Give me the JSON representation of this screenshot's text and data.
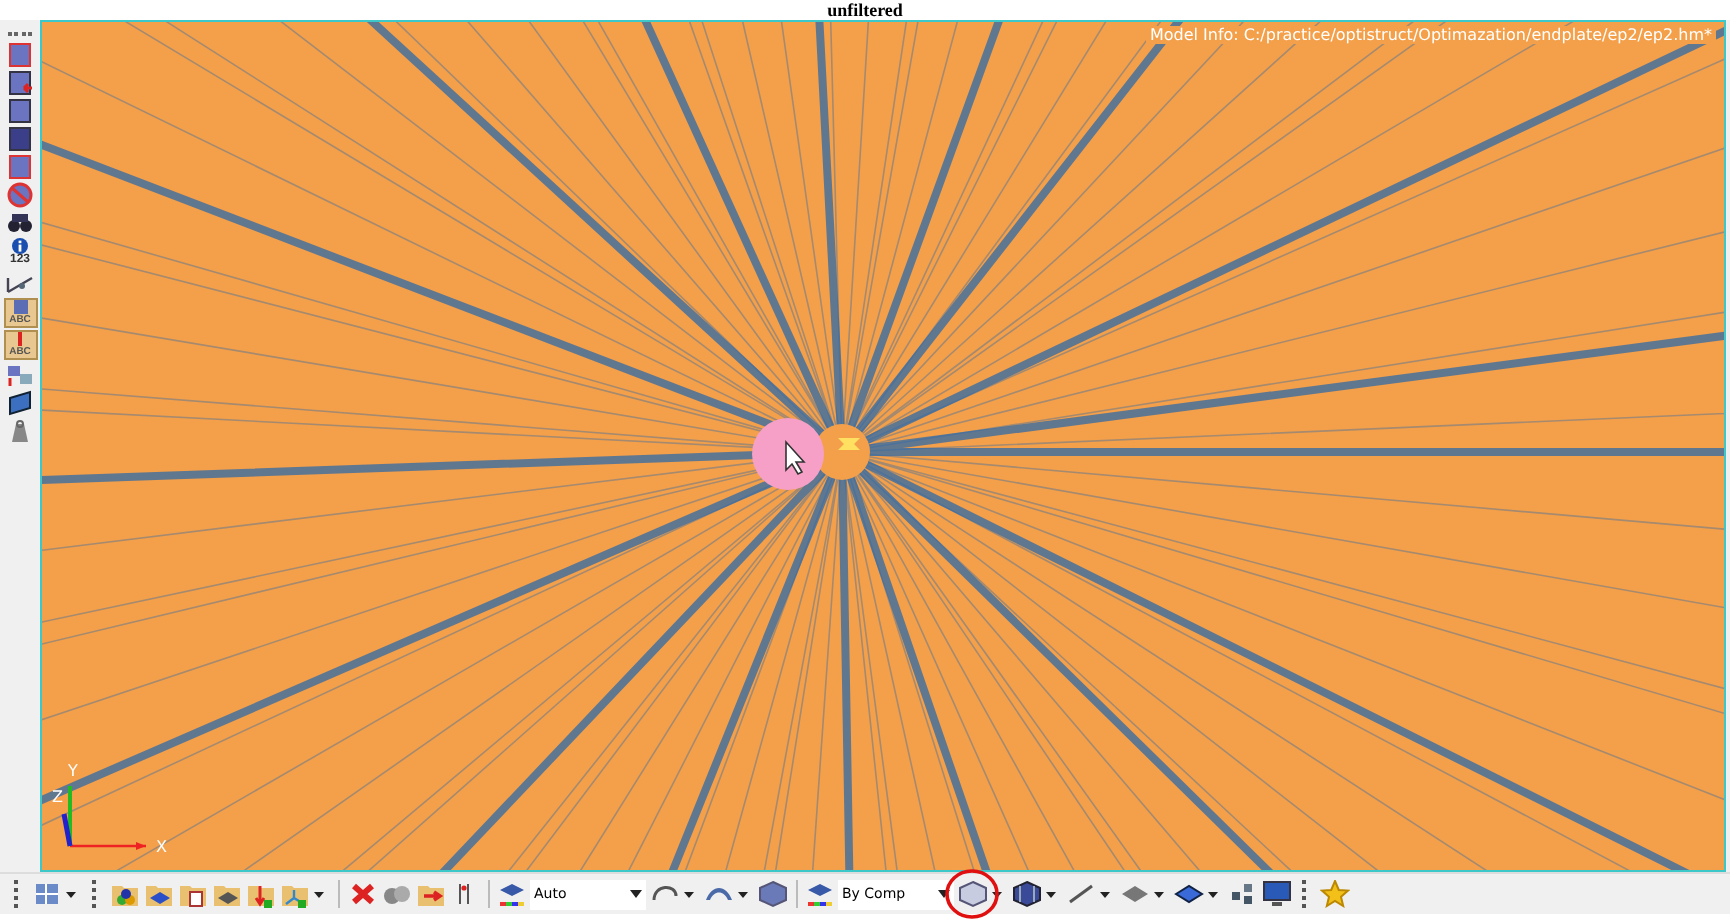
{
  "window": {
    "title": "unfiltered"
  },
  "viewport": {
    "model_info": "Model Info: C:/practice/optistruct/Optimazation/endplate/ep2/ep2.hm*",
    "axes": {
      "x": "X",
      "y": "Y",
      "z": "Z"
    }
  },
  "left_toolbar": [
    {
      "kind": "panel-red"
    },
    {
      "kind": "panel-arrow"
    },
    {
      "kind": "panel"
    },
    {
      "kind": "panel-dark"
    },
    {
      "kind": "panel-frame"
    },
    {
      "kind": "no-entry"
    },
    {
      "kind": "binoculars"
    },
    {
      "kind": "info",
      "label": "123"
    },
    {
      "kind": "measure"
    },
    {
      "kind": "label-tool",
      "label": "ABC",
      "selected": true
    },
    {
      "kind": "label-tool-red",
      "label": "ABC",
      "selected": true
    },
    {
      "kind": "transform"
    },
    {
      "kind": "plate"
    },
    {
      "kind": "weight"
    }
  ],
  "bottom_toolbar": [
    {
      "kind": "grip"
    },
    {
      "kind": "mesh",
      "caret": true
    },
    {
      "kind": "grip"
    },
    {
      "kind": "folder-parts"
    },
    {
      "kind": "folder-blue"
    },
    {
      "kind": "folder-doc"
    },
    {
      "kind": "folder-grey"
    },
    {
      "kind": "folder-down"
    },
    {
      "kind": "folder-axis",
      "caret": true
    },
    {
      "kind": "sep"
    },
    {
      "kind": "delete"
    },
    {
      "kind": "cylinders"
    },
    {
      "kind": "folder-arrow"
    },
    {
      "kind": "numbering"
    },
    {
      "kind": "sep"
    },
    {
      "kind": "color-mode",
      "value": "Auto"
    },
    {
      "kind": "curve",
      "caret": true
    },
    {
      "kind": "shell",
      "caret": true
    },
    {
      "kind": "cube"
    },
    {
      "kind": "sep"
    },
    {
      "kind": "color-mode",
      "value": "By Comp"
    },
    {
      "kind": "cube-light",
      "caret": true,
      "circled": true
    },
    {
      "kind": "cube-mesh",
      "caret": true
    },
    {
      "kind": "line",
      "caret": true
    },
    {
      "kind": "plane",
      "caret": true
    },
    {
      "kind": "plane-blue",
      "caret": true
    },
    {
      "kind": "blocks"
    },
    {
      "kind": "monitor"
    },
    {
      "kind": "grip"
    },
    {
      "kind": "star"
    }
  ]
}
